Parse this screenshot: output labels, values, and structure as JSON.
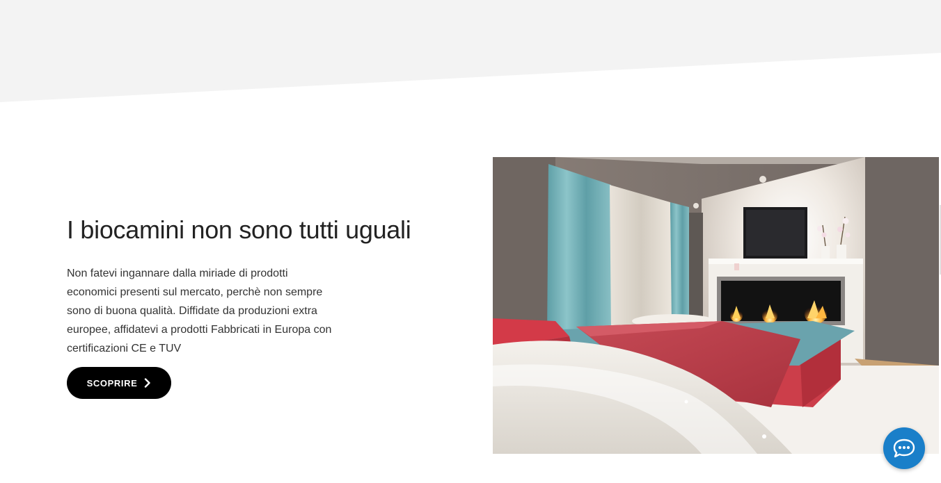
{
  "hero": {
    "heading": "I biocamini non sono tutti uguali",
    "body": "Non fatevi ingannare dalla miriade di prodotti economici presenti sul mercato, perchè non sempre sono di buona qualità. Diffidate da produzioni extra europee, affidatevi a prodotti Fabbricati in Europa con certificazioni CE e TUV",
    "cta_label": "SCOPRIRE",
    "cta_icon": "chevron-right-icon"
  },
  "photo": {
    "subject": "bedroom-with-bio-fireplace-image"
  },
  "chat": {
    "icon": "chat-bubble-icon"
  },
  "colors": {
    "top_band": "#f3f3f3",
    "button_bg": "#000000",
    "chat_bg": "#1a7fc9",
    "text": "#222222"
  }
}
